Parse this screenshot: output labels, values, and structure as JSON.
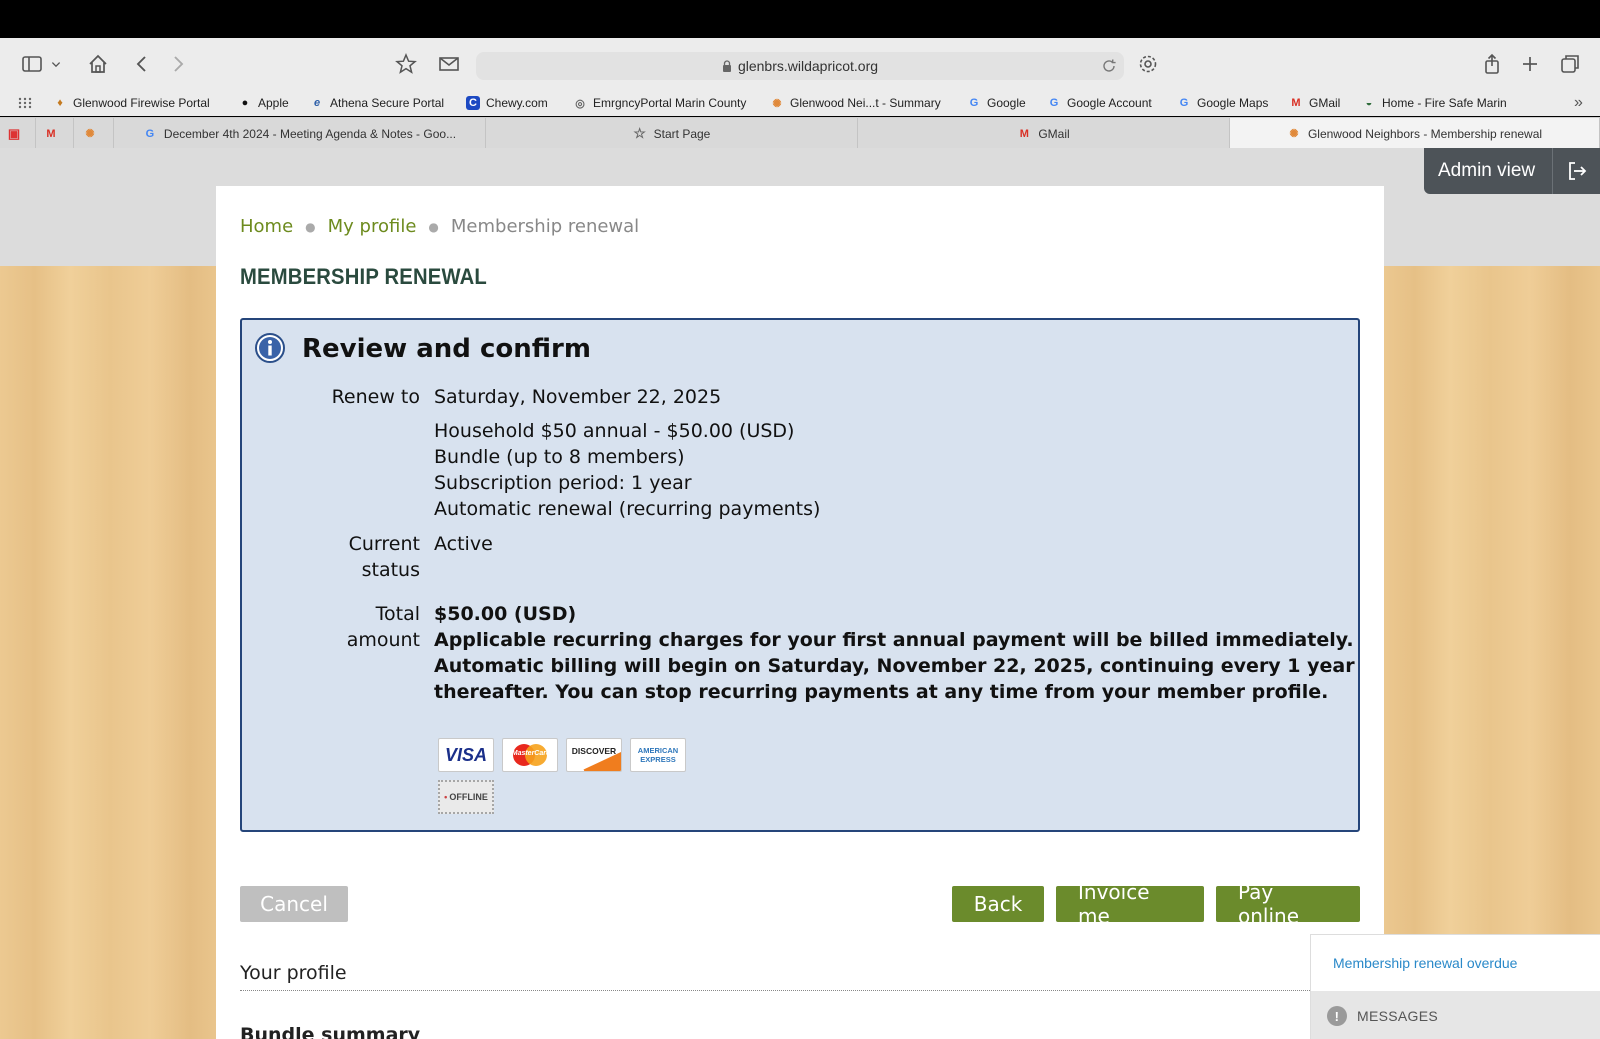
{
  "browser": {
    "url": "glenbrs.wildapricot.org",
    "favorites": [
      {
        "label": "Glenwood Firewise Portal",
        "icon": "firewise-icon"
      },
      {
        "label": "Apple",
        "icon": "apple-icon"
      },
      {
        "label": "Athena Secure Portal",
        "icon": "athena-icon"
      },
      {
        "label": "Chewy.com",
        "icon": "chewy-icon"
      },
      {
        "label": "EmrgncyPortal Marin County",
        "icon": "globe-icon"
      },
      {
        "label": "Glenwood Nei...t - Summary",
        "icon": "flower-icon"
      },
      {
        "label": "Google",
        "icon": "google-icon"
      },
      {
        "label": "Google Account",
        "icon": "google-icon"
      },
      {
        "label": "Google Maps",
        "icon": "google-icon"
      },
      {
        "label": "GMail",
        "icon": "gmail-icon"
      },
      {
        "label": "Home - Fire Safe Marin",
        "icon": "firesafe-icon"
      }
    ],
    "tabs": [
      {
        "label": "December 4th 2024 - Meeting Agenda & Notes - Goo...",
        "icon": "google-icon"
      },
      {
        "label": "Start Page",
        "icon": "star-icon"
      },
      {
        "label": "GMail",
        "icon": "gmail-icon"
      },
      {
        "label": "Glenwood Neighbors - Membership renewal",
        "icon": "flower-icon"
      }
    ]
  },
  "admin": {
    "label": "Admin view"
  },
  "breadcrumb": {
    "home": "Home",
    "profile": "My profile",
    "current": "Membership renewal"
  },
  "page_title": "MEMBERSHIP RENEWAL",
  "review": {
    "heading": "Review and confirm",
    "renew_label": "Renew to",
    "renew_date": "Saturday, November 22, 2025",
    "plan_line1": "Household $50 annual - $50.00 (USD)",
    "plan_line2": "Bundle (up to 8 members)",
    "plan_line3": "Subscription period: 1 year",
    "plan_line4": "Automatic renewal (recurring payments)",
    "status_label1": "Current",
    "status_label2": "status",
    "status_value": "Active",
    "total_label1": "Total",
    "total_label2": "amount",
    "total_value": "$50.00 (USD)",
    "notice_line1": "Applicable recurring charges for your first annual payment will be billed immediately.",
    "notice_line2": "Automatic billing will begin on Saturday, November 22, 2025, continuing every 1 year",
    "notice_line3": "thereafter. You can stop recurring payments at any time from your member profile.",
    "cards": {
      "visa": "VISA",
      "mastercard": "MasterCard",
      "discover": "DISCOVER",
      "amex1": "AMERICAN",
      "amex2": "EXPRESS",
      "offline": "OFFLINE"
    }
  },
  "buttons": {
    "cancel": "Cancel",
    "back": "Back",
    "invoice": "Invoice me",
    "pay": "Pay online"
  },
  "sections": {
    "your_profile": "Your profile",
    "bundle_summary": "Bundle summary"
  },
  "messages": {
    "link": "Membership renewal overdue",
    "label": "MESSAGES"
  },
  "colors": {
    "accent_green": "#6b8b2c",
    "link_green": "#6d8b1e",
    "panel_bg": "#d8e2ef",
    "panel_border": "#25457a"
  }
}
